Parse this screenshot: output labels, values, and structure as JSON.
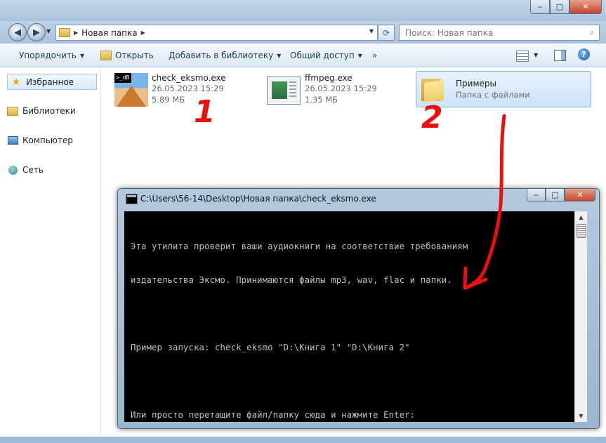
{
  "window": {
    "minimize": "‒",
    "maximize": "□",
    "close": "✕"
  },
  "address": {
    "path": "Новая папка",
    "search_placeholder": "Поиск: Новая папка"
  },
  "toolbar": {
    "organize": "Упорядочить",
    "open": "Открыть",
    "add_to_library": "Добавить в библиотеку",
    "share": "Общий доступ",
    "more": "»"
  },
  "sidebar": {
    "items": [
      {
        "label": "Избранное",
        "icon": "star-icon"
      },
      {
        "label": "Библиотеки",
        "icon": "library-icon"
      },
      {
        "label": "Компьютер",
        "icon": "computer-icon"
      },
      {
        "label": "Сеть",
        "icon": "network-icon"
      }
    ]
  },
  "files": [
    {
      "name": "check_eksmo.exe",
      "date": "26.05.2023 15:29",
      "size": "5.89 МБ",
      "thumb_text": ">_dB"
    },
    {
      "name": "ffmpeg.exe",
      "date": "26.05.2023 15:29",
      "size": "1.35 МБ"
    },
    {
      "name": "Примеры",
      "type": "Папка с файлами"
    }
  ],
  "annotations": {
    "one": "1",
    "two": "2",
    "color": "#e8110e"
  },
  "cmd": {
    "title": "C:\\Users\\56-14\\Desktop\\Новая папка\\check_eksmo.exe",
    "lines": [
      "Эта утилита проверит ваши аудиокниги на соответствие требованиям",
      "издательства Эксмо. Принимаются файлы mp3, wav, flac и папки.",
      "",
      "Пример запуска: check_eksmo \"D:\\Книга 1\" \"D:\\Книга 2\"",
      "",
      "Или просто перетащите файл/папку сюда и нажмите Enter:"
    ]
  }
}
